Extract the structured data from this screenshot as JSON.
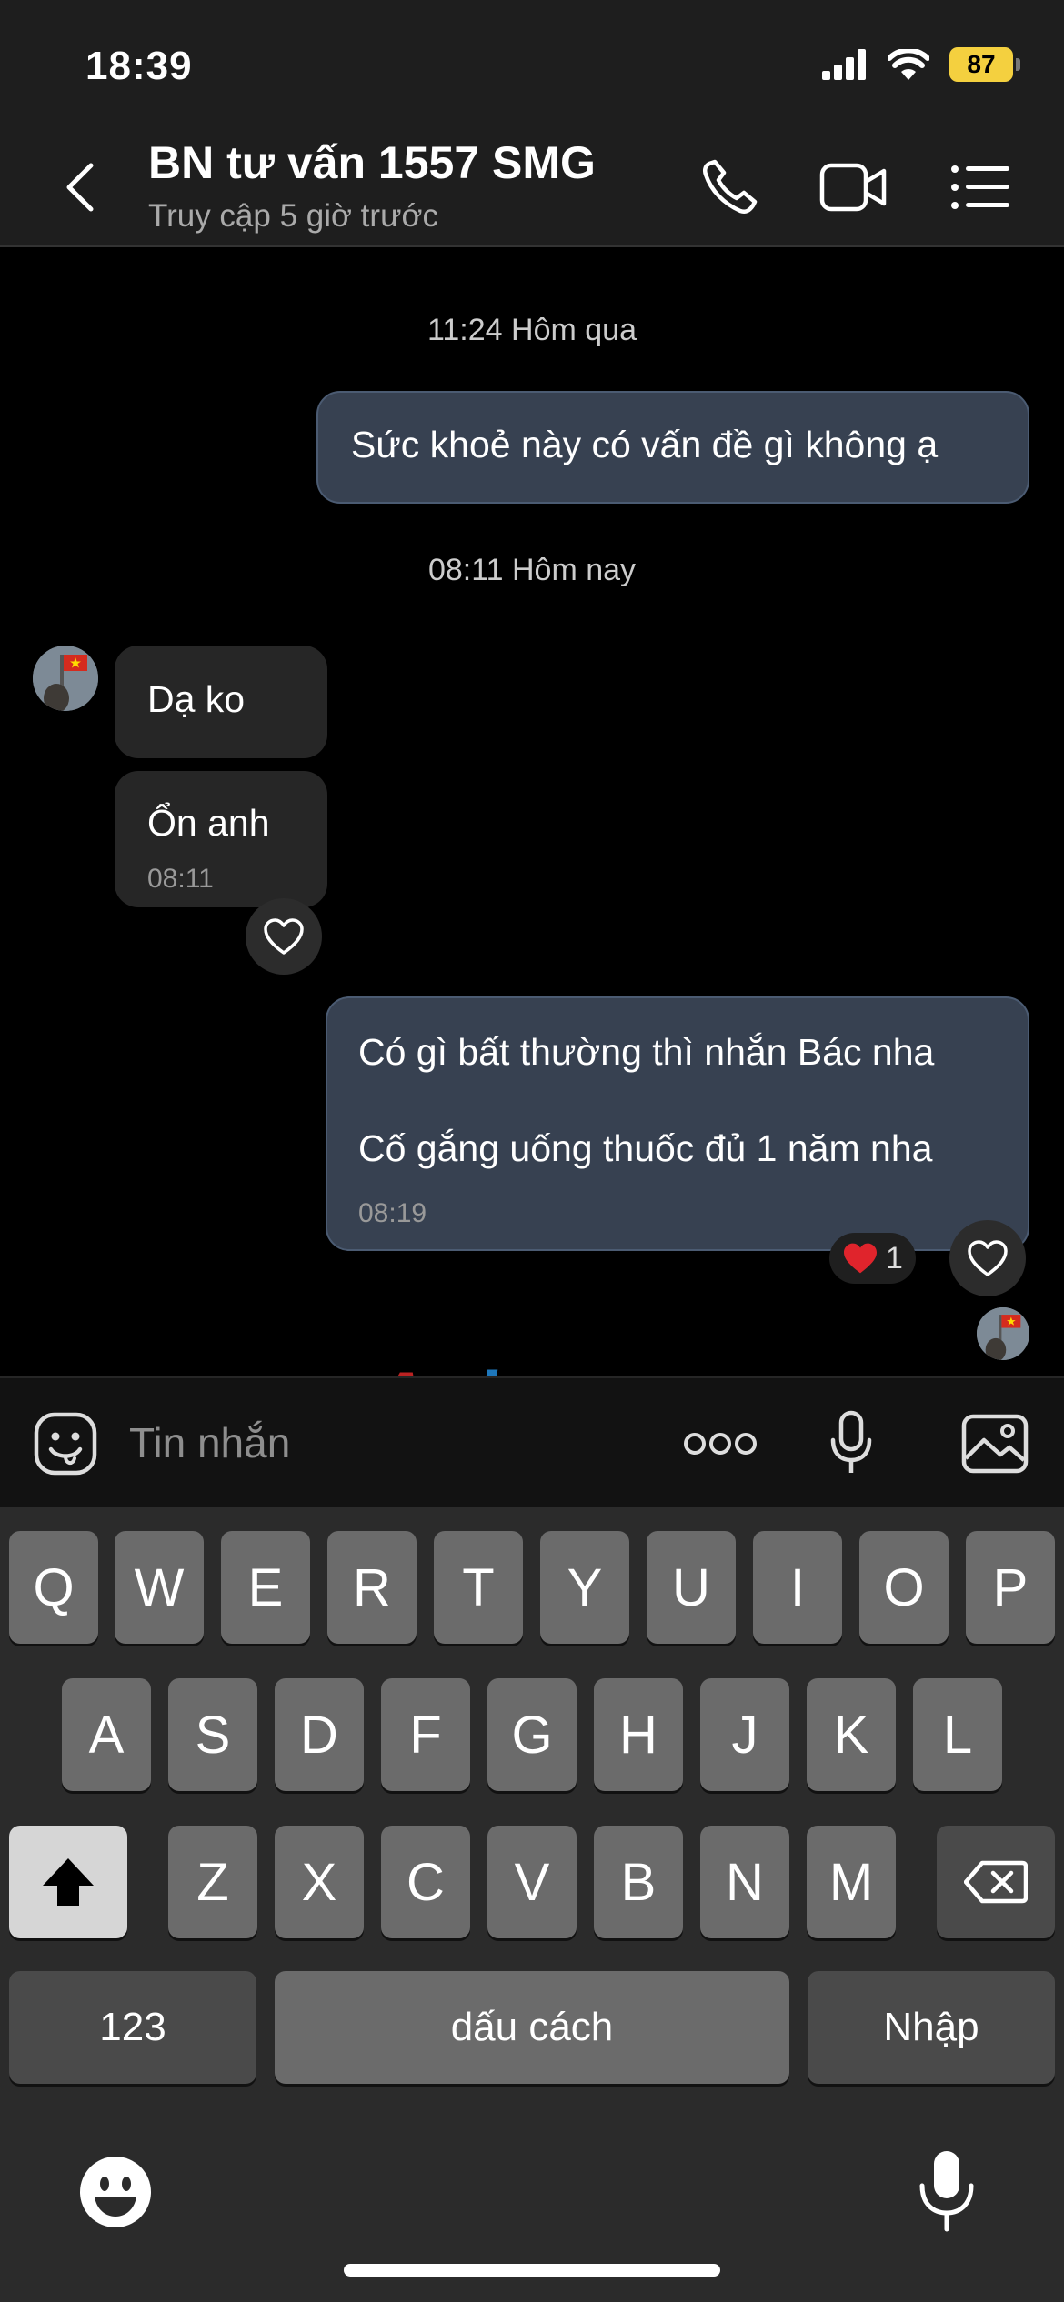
{
  "status_bar": {
    "time": "18:39",
    "battery": "87"
  },
  "header": {
    "title": "BN tư vấn 1557 SMG",
    "subtitle": "Truy cập 5 giờ trước",
    "icons": [
      "back-chevron-icon",
      "phone-icon",
      "video-call-icon",
      "menu-list-icon"
    ]
  },
  "chat": {
    "timestamp_1": "11:24 Hôm qua",
    "msg_out_1": "Sức khoẻ này có vấn đề gì không ạ",
    "timestamp_2": "08:11 Hôm nay",
    "msg_in_1": "Dạ ko",
    "msg_in_2": "Ổn anh",
    "msg_in_2_time": "08:11",
    "msg_out_2_line1": "Có gì bất thường thì nhắn Bác nha",
    "msg_out_2_line2": "Cố gắng uống thuốc đủ 1 năm nha",
    "msg_out_2_time": "08:19",
    "reaction_count": "1"
  },
  "watermark": {
    "prefix": "A",
    "text": "phang"
  },
  "input": {
    "placeholder": "Tin nhắn"
  },
  "keyboard": {
    "row1": [
      "Q",
      "W",
      "E",
      "R",
      "T",
      "Y",
      "U",
      "I",
      "O",
      "P"
    ],
    "row2": [
      "A",
      "S",
      "D",
      "F",
      "G",
      "H",
      "J",
      "K",
      "L"
    ],
    "row3": [
      "Z",
      "X",
      "C",
      "V",
      "B",
      "N",
      "M"
    ],
    "numbers_key": "123",
    "space_key": "dấu cách",
    "return_key": "Nhập"
  }
}
